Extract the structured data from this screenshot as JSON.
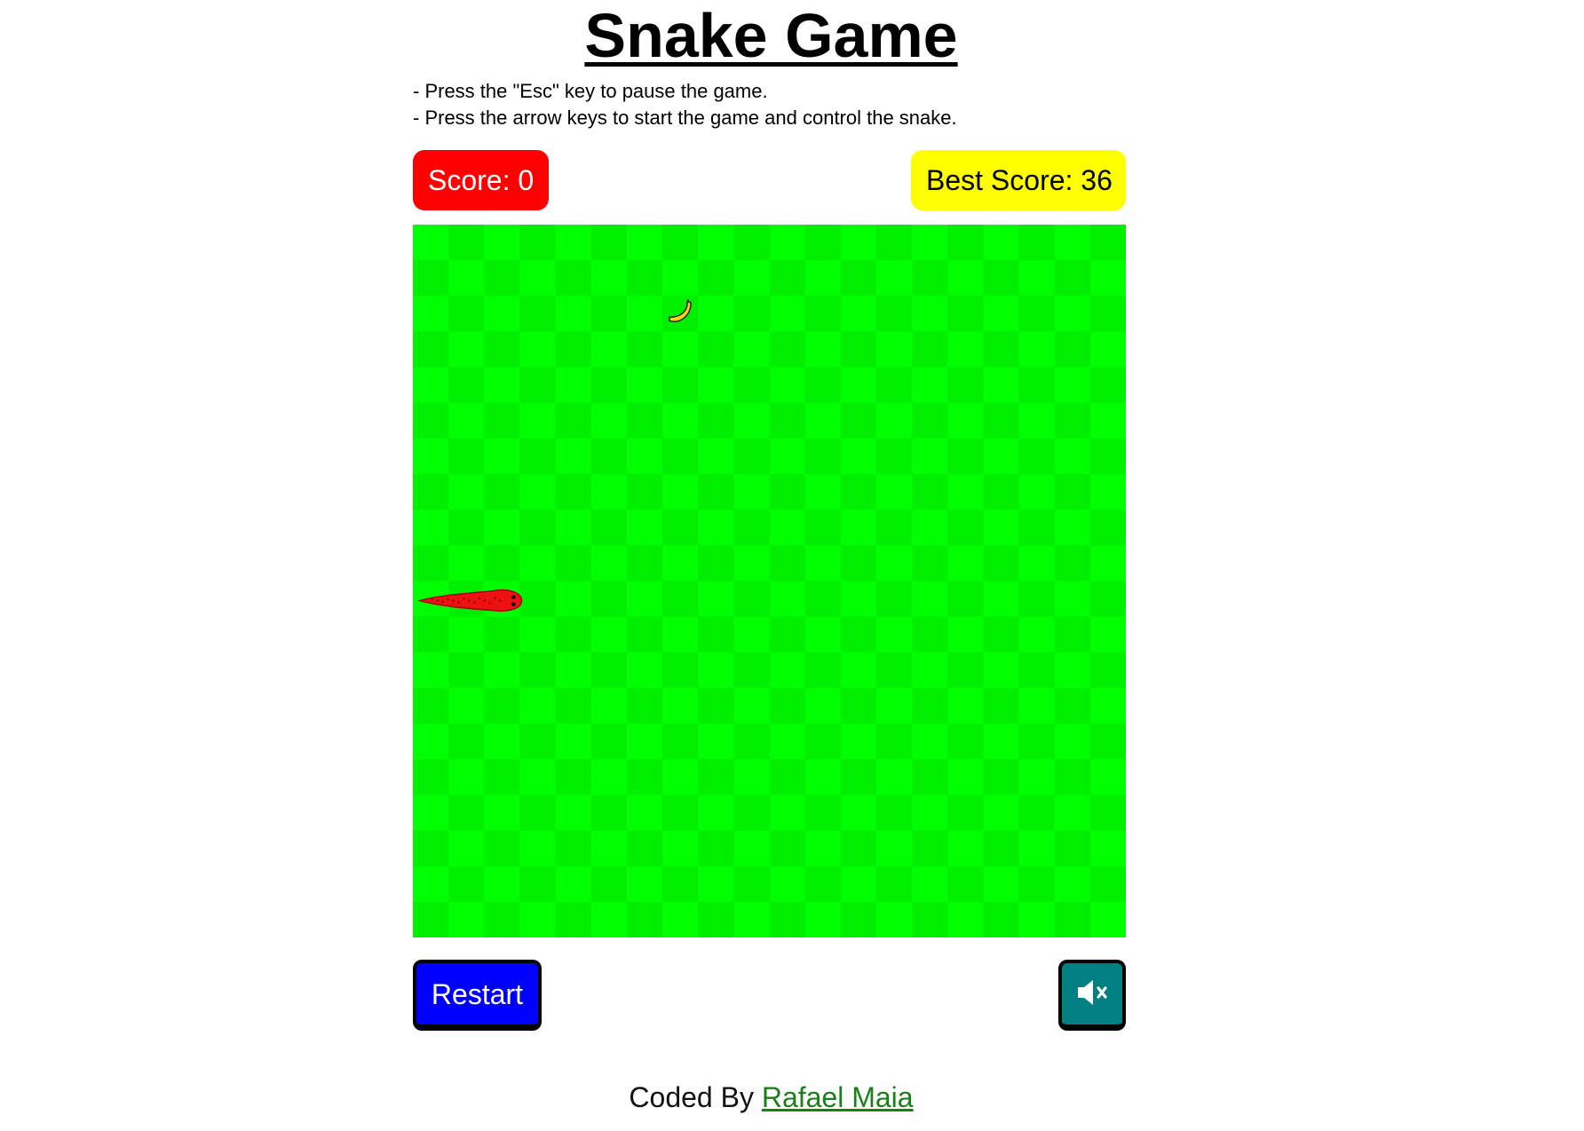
{
  "title": "Snake Game",
  "instructions": [
    "- Press the \"Esc\" key to pause the game.",
    "- Press the arrow keys to start the game and control the snake."
  ],
  "scoreboard": {
    "score_label": "Score: 0",
    "best_label": "Best Score: 36",
    "score_color": "#ff0000",
    "best_color": "#ffff00"
  },
  "board": {
    "grid_columns": 20,
    "grid_rows": 20,
    "light_color": "#00ff00",
    "dark_color": "#00ee00",
    "food": {
      "kind": "banana-icon",
      "col": 7,
      "row": 2
    },
    "snake": {
      "color": "#ee1111",
      "direction": "right",
      "head": {
        "col": 2,
        "row": 10
      },
      "length": 3
    }
  },
  "controls": {
    "restart_label": "Restart",
    "restart_color": "#0000ff",
    "mute_icon": "volume-mute-icon",
    "mute_color": "#008080"
  },
  "footer": {
    "prefix": "Coded By ",
    "author": "Rafael Maia"
  }
}
